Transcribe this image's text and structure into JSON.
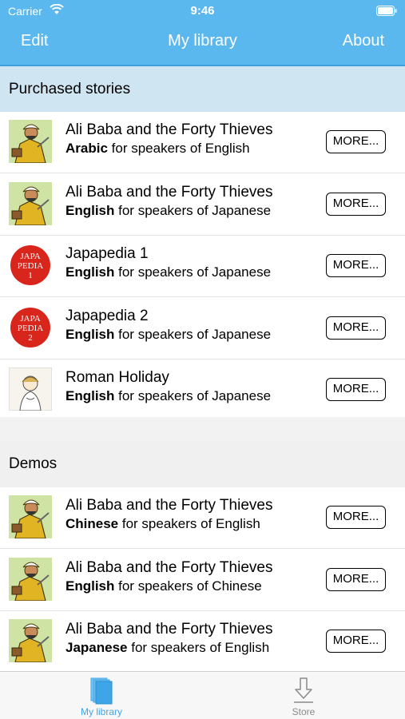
{
  "status_bar": {
    "carrier": "Carrier",
    "time": "9:46"
  },
  "nav": {
    "edit": "Edit",
    "title": "My library",
    "about": "About"
  },
  "sections": {
    "purchased": "Purchased stories",
    "demos": "Demos"
  },
  "purchased_rows": [
    {
      "title": "Ali Baba and the Forty Thieves",
      "lang": "Arabic",
      "rest": " for speakers of English",
      "thumb": "ali-baba",
      "more": "MORE..."
    },
    {
      "title": "Ali Baba and the Forty Thieves",
      "lang": "English",
      "rest": " for speakers of Japanese",
      "thumb": "ali-baba",
      "more": "MORE..."
    },
    {
      "title": "Japapedia 1",
      "lang": "English",
      "rest": " for speakers of Japanese",
      "thumb": "japapedia",
      "thumb_text": [
        "JAPA",
        "PEDIA",
        "1"
      ],
      "more": "MORE..."
    },
    {
      "title": "Japapedia 2",
      "lang": "English",
      "rest": " for speakers of Japanese",
      "thumb": "japapedia",
      "thumb_text": [
        "JAPA",
        "PEDIA",
        "2"
      ],
      "more": "MORE..."
    },
    {
      "title": "Roman Holiday",
      "lang": "English",
      "rest": " for speakers of Japanese",
      "thumb": "roman-holiday",
      "more": "MORE..."
    }
  ],
  "demo_rows": [
    {
      "title": "Ali Baba and the Forty Thieves",
      "lang": "Chinese",
      "rest": " for speakers of English",
      "thumb": "ali-baba",
      "more": "MORE..."
    },
    {
      "title": "Ali Baba and the Forty Thieves",
      "lang": "English",
      "rest": " for speakers of Chinese",
      "thumb": "ali-baba",
      "more": "MORE..."
    },
    {
      "title": "Ali Baba and the Forty Thieves",
      "lang": "Japanese",
      "rest": " for speakers of English",
      "thumb": "ali-baba",
      "more": "MORE..."
    }
  ],
  "tabs": [
    {
      "label": "My library",
      "icon": "library-icon",
      "selected": true
    },
    {
      "label": "Store",
      "icon": "download-icon",
      "selected": false
    }
  ],
  "colors": {
    "nav": "#5bb8ef",
    "tab_active": "#3ea6e8",
    "section_purchased": "#cfe5f2",
    "japapedia_red": "#d9261c"
  }
}
